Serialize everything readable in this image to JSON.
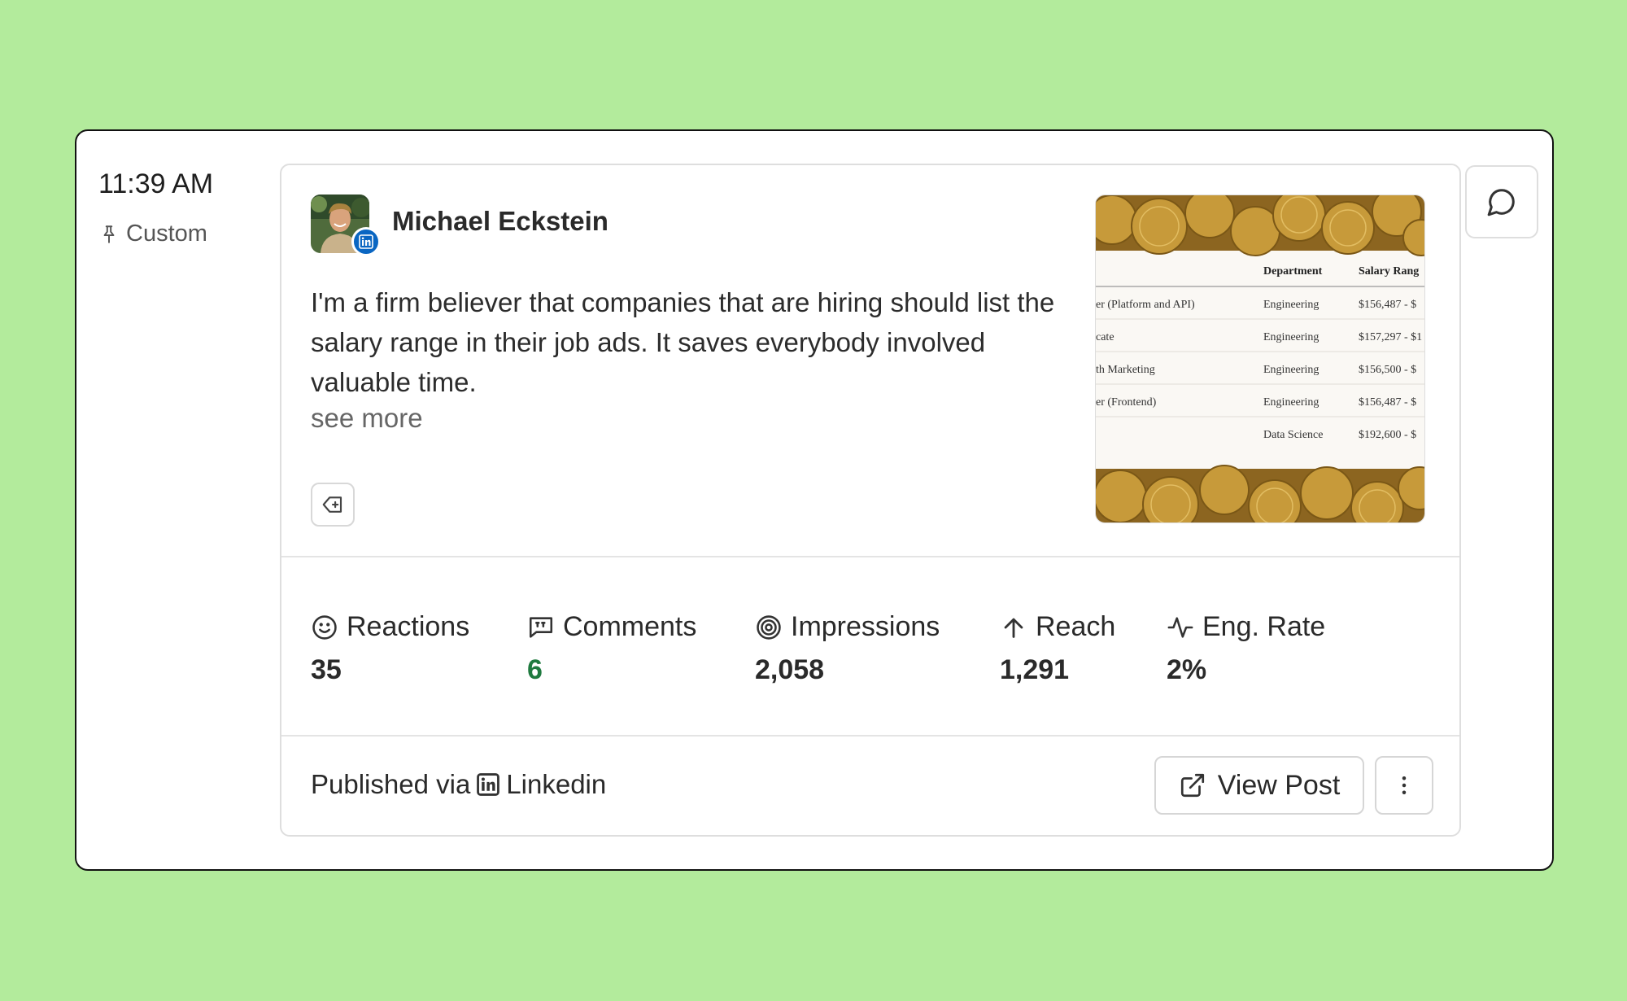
{
  "time": "11:39 AM",
  "schedule_label": "Custom",
  "post": {
    "author": "Michael Eckstein",
    "text": "I'm a firm believer that companies that are hiring should list the salary range in their job ads. It saves everybody involved valuable time.",
    "see_more": "see more",
    "image_table": {
      "headers": [
        "Department",
        "Salary Rang"
      ],
      "rows": [
        [
          "er (Platform and API)",
          "Engineering",
          "$156,487 - $"
        ],
        [
          "cate",
          "Engineering",
          "$157,297 - $1"
        ],
        [
          "th Marketing",
          "Engineering",
          "$156,500 - $"
        ],
        [
          "er (Frontend)",
          "Engineering",
          "$156,487 - $"
        ],
        [
          "",
          "Data Science",
          "$192,600 - $"
        ]
      ]
    }
  },
  "stats": {
    "reactions": {
      "label": "Reactions",
      "value": "35",
      "icon": "smile-icon"
    },
    "comments": {
      "label": "Comments",
      "value": "6",
      "icon": "quote-bubble-icon",
      "color": "#1f7a3f"
    },
    "impressions": {
      "label": "Impressions",
      "value": "2,058",
      "icon": "target-icon"
    },
    "reach": {
      "label": "Reach",
      "value": "1,291",
      "icon": "arrow-up-icon"
    },
    "eng_rate": {
      "label": "Eng. Rate",
      "value": "2%",
      "icon": "activity-icon"
    }
  },
  "footer": {
    "published_prefix": "Published via",
    "platform": "Linkedin",
    "view_post": "View Post"
  },
  "colors": {
    "background": "#b3eb9c",
    "linkedin": "#0a66c2",
    "positive": "#1f7a3f"
  }
}
